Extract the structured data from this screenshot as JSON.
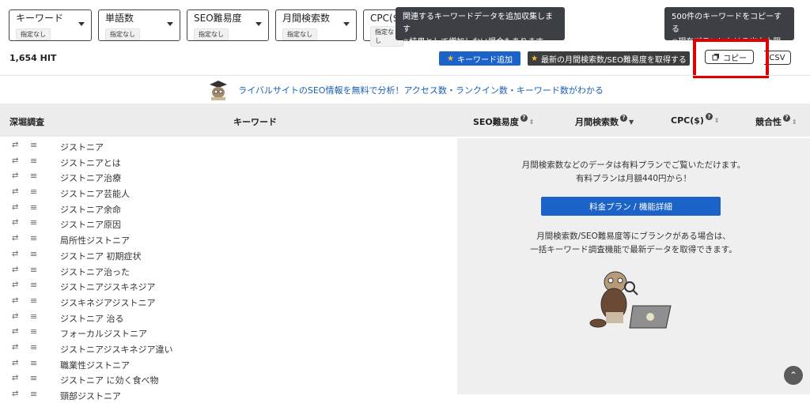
{
  "filters": [
    {
      "label": "キーワード",
      "badge": "指定なし"
    },
    {
      "label": "単語数",
      "badge": "指定なし"
    },
    {
      "label": "SEO難易度",
      "badge": "指定なし"
    },
    {
      "label": "月間検索数",
      "badge": "指定なし"
    },
    {
      "label": "CPC($)",
      "badge": "指定なし"
    }
  ],
  "tooltips": {
    "collect_line1": "関連するキーワードデータを追加収集します",
    "collect_line2": "※結果として増加しない場合もあります",
    "copy_line1": "500件のキーワードをコピーする",
    "copy_line2": "※現在プランにおける出力上限"
  },
  "hits": "1,654 HIT",
  "toolbar": {
    "add_keyword": "キーワード追加",
    "fetch_latest": "最新の月間検索数/SEO難易度を取得する",
    "copy": "コピー",
    "csv": "CSV"
  },
  "promo": {
    "link": "ライバルサイトのSEO情報を無料で分析！アクセス数・ランクイン数・キーワード数がわかる"
  },
  "table": {
    "headers": {
      "deep": "深堀調査",
      "keyword": "キーワード",
      "seo": "SEO難易度",
      "volume": "月間検索数",
      "cpc": "CPC($)",
      "competition": "競合性"
    },
    "rows": [
      "ジストニア",
      "ジストニアとは",
      "ジストニア治療",
      "ジストニア芸能人",
      "ジストニア余命",
      "ジストニア原因",
      "局所性ジストニア",
      "ジストニア 初期症状",
      "ジストニア治った",
      "ジストニアジスキネジア",
      "ジスキネジアジストニア",
      "ジストニア 治る",
      "フォーカルジストニア",
      "ジストニアジスキネジア違い",
      "職業性ジストニア",
      "ジストニア に効く食べ物",
      "頸部ジストニア"
    ]
  },
  "panel": {
    "line1": "月間検索数などのデータは有料プランでご覧いただけます。",
    "line2": "有料プランは月額440円から！",
    "button": "料金プラン / 機能詳細",
    "line3": "月間検索数/SEO難易度等にブランクがある場合は、",
    "line4": "一括キーワード調査機能で最新データを取得できます。"
  },
  "icons": {
    "deep_search": "retweet-icon",
    "drag": "hamburger-icon"
  },
  "colors": {
    "primary_blue": "#1b63c8",
    "dark_button": "#3d3d3d",
    "highlight_red": "#e00000",
    "link_blue": "#1a5fb4"
  }
}
